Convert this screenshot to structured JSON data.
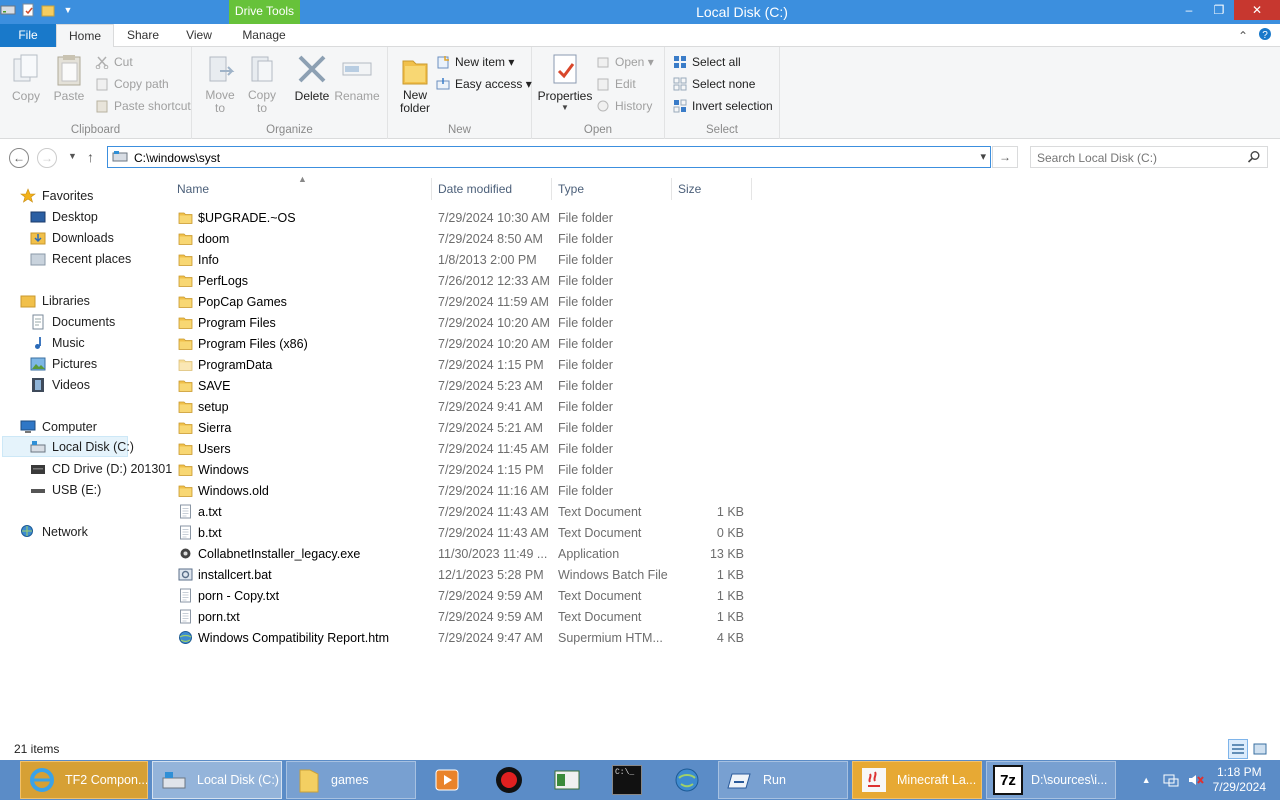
{
  "window": {
    "title": "Local Disk (C:)",
    "context_tab": "Drive Tools",
    "controls": {
      "minimize": "–",
      "maximize": "❐",
      "close": "✕"
    }
  },
  "ribbon_tabs": {
    "file": "File",
    "home": "Home",
    "share": "Share",
    "view": "View",
    "manage": "Manage"
  },
  "ribbon": {
    "clipboard": {
      "label": "Clipboard",
      "copy": "Copy",
      "paste": "Paste",
      "cut": "Cut",
      "copy_path": "Copy path",
      "paste_shortcut": "Paste shortcut"
    },
    "organize": {
      "label": "Organize",
      "move_to": "Move to",
      "copy_to": "Copy to",
      "delete": "Delete",
      "rename": "Rename"
    },
    "new": {
      "label": "New",
      "new_folder": "New folder",
      "new_item": "New item ▾",
      "easy_access": "Easy access ▾"
    },
    "open": {
      "label": "Open",
      "properties": "Properties",
      "open": "Open ▾",
      "edit": "Edit",
      "history": "History"
    },
    "select": {
      "label": "Select",
      "select_all": "Select all",
      "select_none": "Select none",
      "invert_selection": "Invert selection"
    }
  },
  "address": {
    "value": "C:\\windows\\syst"
  },
  "search": {
    "placeholder": "Search Local Disk (C:)"
  },
  "nav": {
    "favorites": "Favorites",
    "desktop": "Desktop",
    "downloads": "Downloads",
    "recent": "Recent places",
    "libraries": "Libraries",
    "documents": "Documents",
    "music": "Music",
    "pictures": "Pictures",
    "videos": "Videos",
    "computer": "Computer",
    "local_disk": "Local Disk (C:)",
    "cd_drive": "CD Drive (D:) 201301",
    "usb": "USB (E:)",
    "network": "Network"
  },
  "columns": {
    "name": "Name",
    "date": "Date modified",
    "type": "Type",
    "size": "Size"
  },
  "files": [
    {
      "name": "$UPGRADE.~OS",
      "date": "7/29/2024 10:30 AM",
      "type": "File folder",
      "size": "",
      "icon": "folder"
    },
    {
      "name": "doom",
      "date": "7/29/2024 8:50 AM",
      "type": "File folder",
      "size": "",
      "icon": "folder"
    },
    {
      "name": "Info",
      "date": "1/8/2013 2:00 PM",
      "type": "File folder",
      "size": "",
      "icon": "folder"
    },
    {
      "name": "PerfLogs",
      "date": "7/26/2012 12:33 AM",
      "type": "File folder",
      "size": "",
      "icon": "folder"
    },
    {
      "name": "PopCap Games",
      "date": "7/29/2024 11:59 AM",
      "type": "File folder",
      "size": "",
      "icon": "folder"
    },
    {
      "name": "Program Files",
      "date": "7/29/2024 10:20 AM",
      "type": "File folder",
      "size": "",
      "icon": "folder"
    },
    {
      "name": "Program Files (x86)",
      "date": "7/29/2024 10:20 AM",
      "type": "File folder",
      "size": "",
      "icon": "folder"
    },
    {
      "name": "ProgramData",
      "date": "7/29/2024 1:15 PM",
      "type": "File folder",
      "size": "",
      "icon": "folder-faded"
    },
    {
      "name": "SAVE",
      "date": "7/29/2024 5:23 AM",
      "type": "File folder",
      "size": "",
      "icon": "folder"
    },
    {
      "name": "setup",
      "date": "7/29/2024 9:41 AM",
      "type": "File folder",
      "size": "",
      "icon": "folder"
    },
    {
      "name": "Sierra",
      "date": "7/29/2024 5:21 AM",
      "type": "File folder",
      "size": "",
      "icon": "folder"
    },
    {
      "name": "Users",
      "date": "7/29/2024 11:45 AM",
      "type": "File folder",
      "size": "",
      "icon": "folder"
    },
    {
      "name": "Windows",
      "date": "7/29/2024 1:15 PM",
      "type": "File folder",
      "size": "",
      "icon": "folder"
    },
    {
      "name": "Windows.old",
      "date": "7/29/2024 11:16 AM",
      "type": "File folder",
      "size": "",
      "icon": "folder"
    },
    {
      "name": "a.txt",
      "date": "7/29/2024 11:43 AM",
      "type": "Text Document",
      "size": "1 KB",
      "icon": "text"
    },
    {
      "name": "b.txt",
      "date": "7/29/2024 11:43 AM",
      "type": "Text Document",
      "size": "0 KB",
      "icon": "text"
    },
    {
      "name": "CollabnetInstaller_legacy.exe",
      "date": "11/30/2023 11:49 ...",
      "type": "Application",
      "size": "13 KB",
      "icon": "exe"
    },
    {
      "name": "installcert.bat",
      "date": "12/1/2023 5:28 PM",
      "type": "Windows Batch File",
      "size": "1 KB",
      "icon": "bat"
    },
    {
      "name": "porn - Copy.txt",
      "date": "7/29/2024 9:59 AM",
      "type": "Text Document",
      "size": "1 KB",
      "icon": "text"
    },
    {
      "name": "porn.txt",
      "date": "7/29/2024 9:59 AM",
      "type": "Text Document",
      "size": "1 KB",
      "icon": "text"
    },
    {
      "name": "Windows Compatibility Report.htm",
      "date": "7/29/2024 9:47 AM",
      "type": "Supermium HTM...",
      "size": "4 KB",
      "icon": "web"
    }
  ],
  "status": {
    "count": "21 items"
  },
  "taskbar": {
    "ie": "TF2 Compon...",
    "explorer": "Local Disk (C:)",
    "games": "games",
    "run": "Run",
    "minecraft": "Minecraft La...",
    "sevenzip": "D:\\sources\\i...",
    "sevenzip_logo": "7z",
    "cmd_prompt": "C:\\_",
    "time": "1:18 PM",
    "date": "7/29/2024"
  }
}
